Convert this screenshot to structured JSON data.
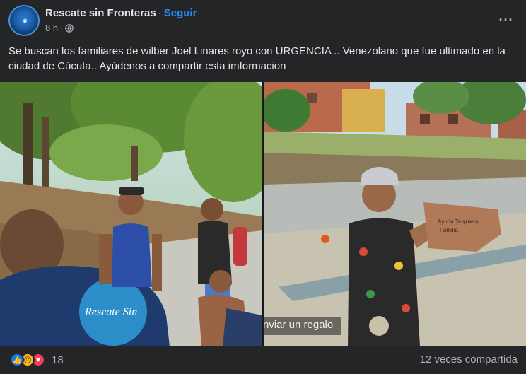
{
  "header": {
    "page_name": "Rescate sin Fronteras",
    "separator": "·",
    "follow_label": "Seguir",
    "time": "8 h",
    "time_separator": "·",
    "more_label": "···",
    "avatar_icon": "rescue-logo-icon",
    "privacy_icon": "globe-icon"
  },
  "post": {
    "text": "Se buscan los familiares de wilber Joel Linares royo con URGENCIA .. Venezolano que fue ultimado en la ciudad de Cúcuta.. Ayúdenos a compartir esta imformacion"
  },
  "media": {
    "overlay_text": "nviar un regalo",
    "left_photo_shirt_text": "Rescate Sin Fronteras",
    "right_photo_hand_text": "Ayuda Te quiero Familia ... Mi gente"
  },
  "footer": {
    "reactions": [
      "like-icon",
      "sad-icon",
      "love-icon"
    ],
    "reaction_count": "18",
    "shares": "12 veces compartida"
  },
  "colors": {
    "background": "#242526",
    "link": "#2d88ff",
    "text": "#e4e6eb",
    "muted": "#b0b3b8"
  }
}
